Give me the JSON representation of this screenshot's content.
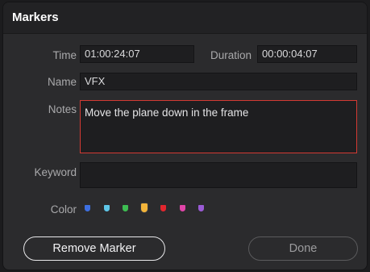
{
  "dialog": {
    "title": "Markers"
  },
  "fields": {
    "time": {
      "label": "Time",
      "value": "01:00:24:07"
    },
    "duration": {
      "label": "Duration",
      "value": "00:00:04:07"
    },
    "name": {
      "label": "Name",
      "value": "VFX"
    },
    "notes": {
      "label": "Notes",
      "value": "Move the plane down in the frame"
    },
    "keyword": {
      "label": "Keyword",
      "value": ""
    }
  },
  "color": {
    "label": "Color",
    "selected": "yellow",
    "swatches": [
      {
        "name": "blue",
        "hex": "#3d6fe0"
      },
      {
        "name": "cyan",
        "hex": "#5ec6e8"
      },
      {
        "name": "green",
        "hex": "#3dbd52"
      },
      {
        "name": "yellow",
        "hex": "#f2b43a"
      },
      {
        "name": "red",
        "hex": "#e2262e"
      },
      {
        "name": "pink",
        "hex": "#e045a8"
      },
      {
        "name": "purple",
        "hex": "#9b5bd6"
      }
    ]
  },
  "buttons": {
    "remove_marker": "Remove Marker",
    "done": "Done"
  }
}
